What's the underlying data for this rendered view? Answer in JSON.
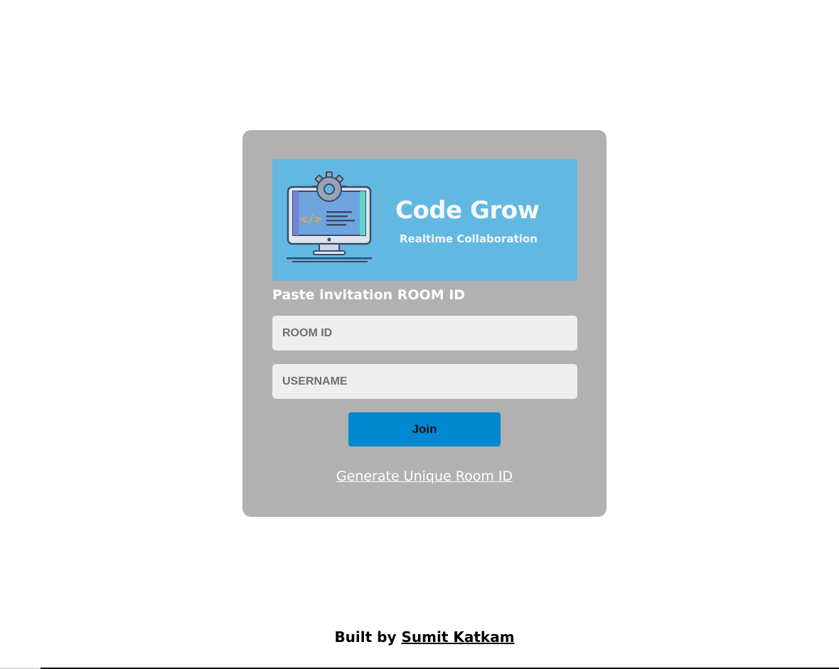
{
  "banner": {
    "title": "Code Grow",
    "subtitle": "Realtime Collaboration",
    "illustration_icon": "monitor-code-gear-icon",
    "background_color": "#62b8e0"
  },
  "form": {
    "heading": "Paste invitation ROOM ID",
    "room_id": {
      "placeholder": "ROOM ID",
      "value": ""
    },
    "username": {
      "placeholder": "USERNAME",
      "value": ""
    },
    "join_label": "Join",
    "generate_link_label": "Generate Unique Room ID"
  },
  "footer": {
    "prefix": "Built by ",
    "author": "Sumit Katkam"
  },
  "colors": {
    "card_background": "#b1b1b1",
    "join_button": "#0088d1",
    "input_background": "#eeeeee"
  }
}
